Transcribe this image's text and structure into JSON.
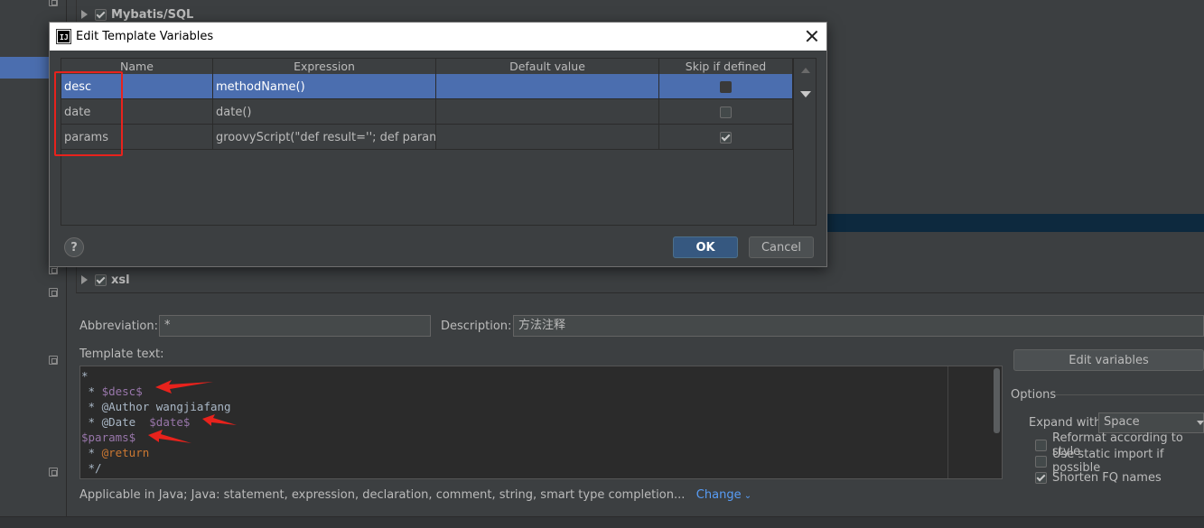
{
  "tree": {
    "items": [
      {
        "label": "Mybatis/SQL",
        "checked": true
      },
      {
        "label": "xsl",
        "checked": true
      }
    ]
  },
  "form": {
    "abbreviation_label": "Abbreviation:",
    "abbreviation_value": "*",
    "description_label": "Description:",
    "description_value": "方法注释",
    "template_text_label": "Template text:",
    "template_lines": [
      "*",
      " * $desc$",
      " * @Author wangjiafang",
      " * @Date  $date$",
      "$params$",
      " * @return",
      " */"
    ],
    "edit_variables_label": "Edit variables",
    "options_title": "Options",
    "expand_with_label": "Expand with",
    "expand_with_value": "Space",
    "options": [
      {
        "label": "Reformat according to style",
        "checked": false
      },
      {
        "label": "Use static import if possible",
        "checked": false
      },
      {
        "label": "Shorten FQ names",
        "checked": true
      }
    ],
    "applicable_text": "Applicable in Java; Java: statement, expression, declaration, comment, string, smart type completion...",
    "change_link": "Change"
  },
  "dialog": {
    "title": "Edit Template Variables",
    "app_icon": "IJ",
    "columns": [
      "Name",
      "Expression",
      "Default value",
      "Skip if defined"
    ],
    "rows": [
      {
        "name": "desc",
        "expression": "methodName()",
        "default_value": "",
        "skip_if_defined": false,
        "selected": true
      },
      {
        "name": "date",
        "expression": "date()",
        "default_value": "",
        "skip_if_defined": false,
        "selected": false
      },
      {
        "name": "params",
        "expression": "groovyScript(\"def result=''; def params...",
        "default_value": "",
        "skip_if_defined": true,
        "selected": false
      }
    ],
    "help_label": "?",
    "ok_label": "OK",
    "cancel_label": "Cancel"
  },
  "colors": {
    "background": "#3c3f41",
    "selection": "#4b6eaf",
    "ok_button": "#365880",
    "annotation_red": "#e8221c",
    "template_variable": "#9876aa",
    "template_tag": "#cc7832"
  }
}
